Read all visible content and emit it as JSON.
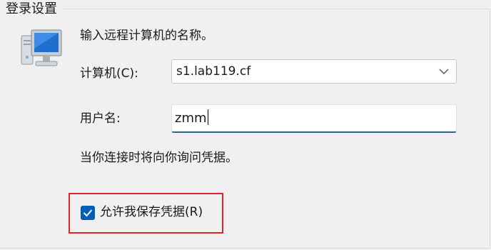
{
  "group": {
    "title": "登录设置"
  },
  "prompt": "输入远程计算机的名称。",
  "computer": {
    "label": "计算机(C):",
    "value": "s1.lab119.cf"
  },
  "user": {
    "label": "用户名:",
    "value": "zmm"
  },
  "info": "当你连接时将向你询问凭据。",
  "save_credentials": {
    "label": "允许我保存凭据(R)",
    "checked": true
  },
  "icons": {
    "computer": "computer-monitor-icon",
    "dropdown": "chevron-down-icon",
    "check": "checkmark-icon"
  },
  "colors": {
    "accent": "#005fb8",
    "highlight": "#e0262a",
    "textbox_focus": "#1f6f8b"
  }
}
